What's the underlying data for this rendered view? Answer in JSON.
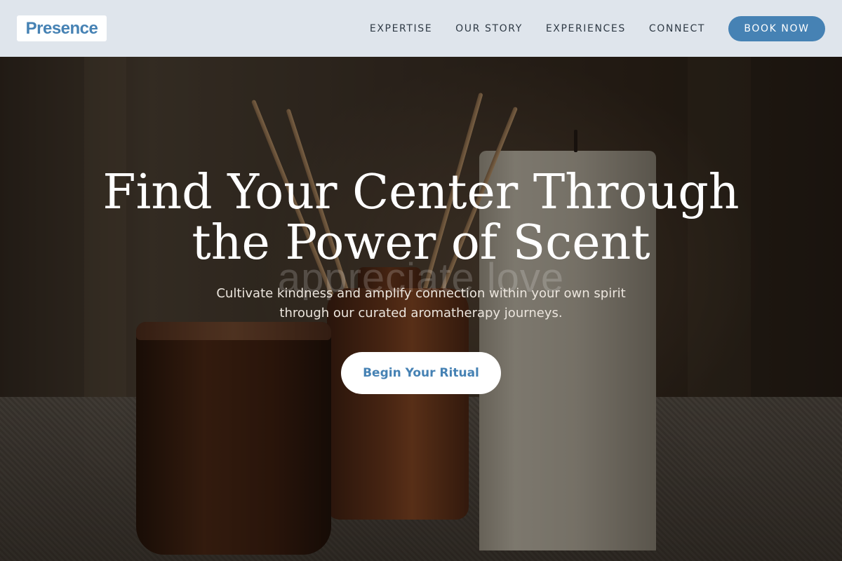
{
  "header": {
    "logo_text": "Presence",
    "nav": {
      "expertise": "EXPERTISE",
      "our_story": "OUR STORY",
      "experiences": "EXPERIENCES",
      "connect": "CONNECT"
    },
    "book_button": "BOOK NOW"
  },
  "hero": {
    "headline_line1": "Find Your Center Through",
    "headline_line2": "the Power of Scent",
    "background_overlay_text": "appreciate love",
    "subtext_line1": "Cultivate kindness and amplify connection within your own spirit",
    "subtext_line2": "through our curated aromatherapy journeys.",
    "cta_button": "Begin Your Ritual"
  },
  "colors": {
    "accent": "#4682b4",
    "header_bg": "#dfe5ec",
    "text_light": "#ffffff"
  },
  "icons": {
    "background_image": "candles-and-reed-diffuser-photo"
  }
}
